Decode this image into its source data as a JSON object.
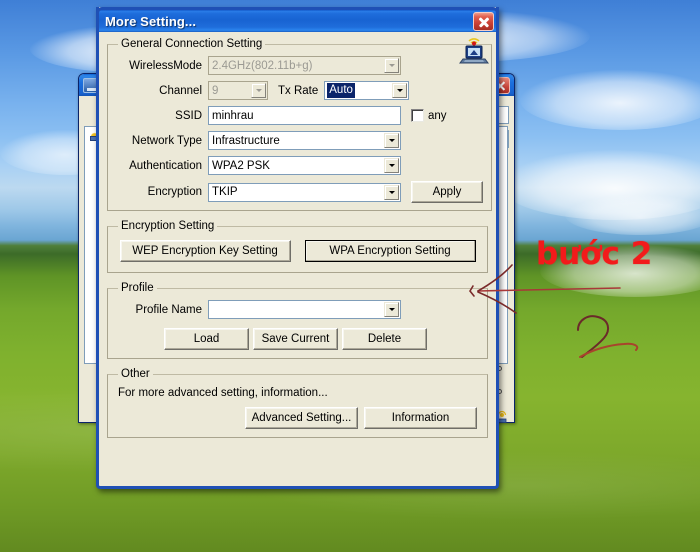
{
  "desktop": {
    "wallpaper_name": "bliss-wallpaper"
  },
  "background_window": {
    "title": "",
    "close_label": "×",
    "list_items": [
      "",
      "",
      ""
    ]
  },
  "dialog": {
    "title": "More Setting...",
    "close_label": "×",
    "wifi_icon_name": "wireless-laptop-icon",
    "general": {
      "legend": "General Connection Setting",
      "wireless_mode": {
        "label": "WirelessMode",
        "value": "2.4GHz(802.11b+g)",
        "disabled": true
      },
      "channel": {
        "label": "Channel",
        "value": "9",
        "disabled": true
      },
      "tx_rate": {
        "label": "Tx Rate",
        "value": "Auto",
        "selected": true
      },
      "ssid": {
        "label": "SSID",
        "value": "minhrau",
        "placeholder": ""
      },
      "any": {
        "label": "any",
        "checked": false
      },
      "network_type": {
        "label": "Network Type",
        "value": "Infrastructure"
      },
      "authentication": {
        "label": "Authentication",
        "value": "WPA2 PSK"
      },
      "encryption": {
        "label": "Encryption",
        "value": "TKIP"
      },
      "apply_label": "Apply"
    },
    "encryption_setting": {
      "legend": "Encryption Setting",
      "wep_button": "WEP Encryption Key Setting",
      "wpa_button": "WPA Encryption Setting"
    },
    "profile": {
      "legend": "Profile",
      "name_label": "Profile Name",
      "name_value": "",
      "load_label": "Load",
      "save_label": "Save Current",
      "delete_label": "Delete"
    },
    "other": {
      "legend": "Other",
      "description": "For more advanced setting, information...",
      "advanced_label": "Advanced Setting...",
      "information_label": "Information"
    }
  },
  "annotations": {
    "step_text": "bước 2",
    "step_color": "#f21b1b",
    "arrow_name": "hand-drawn-arrow",
    "digit_name": "hand-drawn-two"
  }
}
